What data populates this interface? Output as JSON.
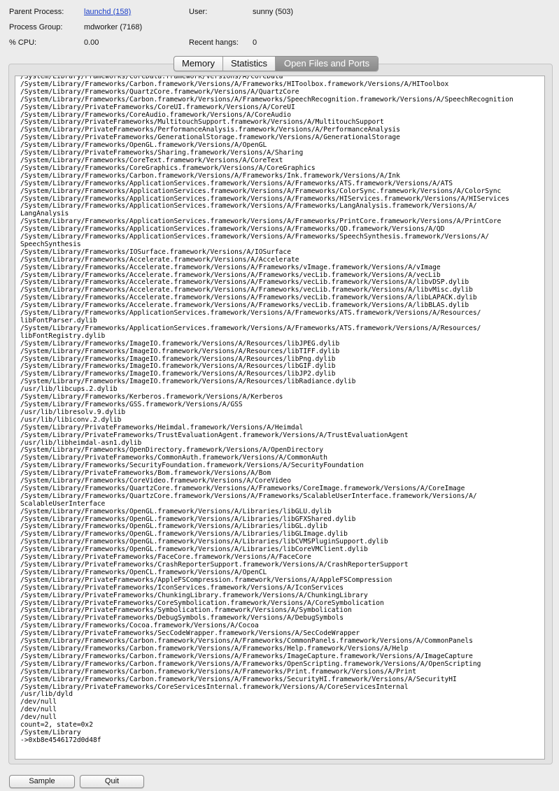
{
  "info": {
    "parent_process_label": "Parent Process:",
    "parent_process_value": "launchd (158)",
    "user_label": "User:",
    "user_value": "sunny (503)",
    "process_group_label": "Process Group:",
    "process_group_value": "mdworker (7168)",
    "cpu_label": "% CPU:",
    "cpu_value": "0.00",
    "recent_hangs_label": "Recent hangs:",
    "recent_hangs_value": "0"
  },
  "tabs": [
    {
      "label": "Memory",
      "active": false
    },
    {
      "label": "Statistics",
      "active": false
    },
    {
      "label": "Open Files and Ports",
      "active": true
    }
  ],
  "open_files": [
    "/System/Library/Frameworks/CoreData.framework/Versions/A/CoreData",
    "/System/Library/Frameworks/Carbon.framework/Versions/A/Frameworks/HIToolbox.framework/Versions/A/HIToolbox",
    "/System/Library/Frameworks/QuartzCore.framework/Versions/A/QuartzCore",
    "/System/Library/Frameworks/Carbon.framework/Versions/A/Frameworks/SpeechRecognition.framework/Versions/A/SpeechRecognition",
    "/System/Library/PrivateFrameworks/CoreUI.framework/Versions/A/CoreUI",
    "/System/Library/Frameworks/CoreAudio.framework/Versions/A/CoreAudio",
    "/System/Library/PrivateFrameworks/MultitouchSupport.framework/Versions/A/MultitouchSupport",
    "/System/Library/PrivateFrameworks/PerformanceAnalysis.framework/Versions/A/PerformanceAnalysis",
    "/System/Library/PrivateFrameworks/GenerationalStorage.framework/Versions/A/GenerationalStorage",
    "/System/Library/Frameworks/OpenGL.framework/Versions/A/OpenGL",
    "/System/Library/PrivateFrameworks/Sharing.framework/Versions/A/Sharing",
    "/System/Library/Frameworks/CoreText.framework/Versions/A/CoreText",
    "/System/Library/Frameworks/CoreGraphics.framework/Versions/A/CoreGraphics",
    "/System/Library/Frameworks/Carbon.framework/Versions/A/Frameworks/Ink.framework/Versions/A/Ink",
    "/System/Library/Frameworks/ApplicationServices.framework/Versions/A/Frameworks/ATS.framework/Versions/A/ATS",
    "/System/Library/Frameworks/ApplicationServices.framework/Versions/A/Frameworks/ColorSync.framework/Versions/A/ColorSync",
    "/System/Library/Frameworks/ApplicationServices.framework/Versions/A/Frameworks/HIServices.framework/Versions/A/HIServices",
    "/System/Library/Frameworks/ApplicationServices.framework/Versions/A/Frameworks/LangAnalysis.framework/Versions/A/\nLangAnalysis",
    "/System/Library/Frameworks/ApplicationServices.framework/Versions/A/Frameworks/PrintCore.framework/Versions/A/PrintCore",
    "/System/Library/Frameworks/ApplicationServices.framework/Versions/A/Frameworks/QD.framework/Versions/A/QD",
    "/System/Library/Frameworks/ApplicationServices.framework/Versions/A/Frameworks/SpeechSynthesis.framework/Versions/A/\nSpeechSynthesis",
    "/System/Library/Frameworks/IOSurface.framework/Versions/A/IOSurface",
    "/System/Library/Frameworks/Accelerate.framework/Versions/A/Accelerate",
    "/System/Library/Frameworks/Accelerate.framework/Versions/A/Frameworks/vImage.framework/Versions/A/vImage",
    "/System/Library/Frameworks/Accelerate.framework/Versions/A/Frameworks/vecLib.framework/Versions/A/vecLib",
    "/System/Library/Frameworks/Accelerate.framework/Versions/A/Frameworks/vecLib.framework/Versions/A/libvDSP.dylib",
    "/System/Library/Frameworks/Accelerate.framework/Versions/A/Frameworks/vecLib.framework/Versions/A/libvMisc.dylib",
    "/System/Library/Frameworks/Accelerate.framework/Versions/A/Frameworks/vecLib.framework/Versions/A/libLAPACK.dylib",
    "/System/Library/Frameworks/Accelerate.framework/Versions/A/Frameworks/vecLib.framework/Versions/A/libBLAS.dylib",
    "/System/Library/Frameworks/ApplicationServices.framework/Versions/A/Frameworks/ATS.framework/Versions/A/Resources/\nlibFontParser.dylib",
    "/System/Library/Frameworks/ApplicationServices.framework/Versions/A/Frameworks/ATS.framework/Versions/A/Resources/\nlibFontRegistry.dylib",
    "/System/Library/Frameworks/ImageIO.framework/Versions/A/Resources/libJPEG.dylib",
    "/System/Library/Frameworks/ImageIO.framework/Versions/A/Resources/libTIFF.dylib",
    "/System/Library/Frameworks/ImageIO.framework/Versions/A/Resources/libPng.dylib",
    "/System/Library/Frameworks/ImageIO.framework/Versions/A/Resources/libGIF.dylib",
    "/System/Library/Frameworks/ImageIO.framework/Versions/A/Resources/libJP2.dylib",
    "/System/Library/Frameworks/ImageIO.framework/Versions/A/Resources/libRadiance.dylib",
    "/usr/lib/libcups.2.dylib",
    "/System/Library/Frameworks/Kerberos.framework/Versions/A/Kerberos",
    "/System/Library/Frameworks/GSS.framework/Versions/A/GSS",
    "/usr/lib/libresolv.9.dylib",
    "/usr/lib/libiconv.2.dylib",
    "/System/Library/PrivateFrameworks/Heimdal.framework/Versions/A/Heimdal",
    "/System/Library/PrivateFrameworks/TrustEvaluationAgent.framework/Versions/A/TrustEvaluationAgent",
    "/usr/lib/libheimdal-asn1.dylib",
    "/System/Library/Frameworks/OpenDirectory.framework/Versions/A/OpenDirectory",
    "/System/Library/PrivateFrameworks/CommonAuth.framework/Versions/A/CommonAuth",
    "/System/Library/Frameworks/SecurityFoundation.framework/Versions/A/SecurityFoundation",
    "/System/Library/PrivateFrameworks/Bom.framework/Versions/A/Bom",
    "/System/Library/Frameworks/CoreVideo.framework/Versions/A/CoreVideo",
    "/System/Library/Frameworks/QuartzCore.framework/Versions/A/Frameworks/CoreImage.framework/Versions/A/CoreImage",
    "/System/Library/Frameworks/QuartzCore.framework/Versions/A/Frameworks/ScalableUserInterface.framework/Versions/A/\nScalableUserInterface",
    "/System/Library/Frameworks/OpenGL.framework/Versions/A/Libraries/libGLU.dylib",
    "/System/Library/Frameworks/OpenGL.framework/Versions/A/Libraries/libGFXShared.dylib",
    "/System/Library/Frameworks/OpenGL.framework/Versions/A/Libraries/libGL.dylib",
    "/System/Library/Frameworks/OpenGL.framework/Versions/A/Libraries/libGLImage.dylib",
    "/System/Library/Frameworks/OpenGL.framework/Versions/A/Libraries/libCVMSPluginSupport.dylib",
    "/System/Library/Frameworks/OpenGL.framework/Versions/A/Libraries/libCoreVMClient.dylib",
    "/System/Library/PrivateFrameworks/FaceCore.framework/Versions/A/FaceCore",
    "/System/Library/PrivateFrameworks/CrashReporterSupport.framework/Versions/A/CrashReporterSupport",
    "/System/Library/Frameworks/OpenCL.framework/Versions/A/OpenCL",
    "/System/Library/PrivateFrameworks/AppleFSCompression.framework/Versions/A/AppleFSCompression",
    "/System/Library/PrivateFrameworks/IconServices.framework/Versions/A/IconServices",
    "/System/Library/PrivateFrameworks/ChunkingLibrary.framework/Versions/A/ChunkingLibrary",
    "/System/Library/PrivateFrameworks/CoreSymbolication.framework/Versions/A/CoreSymbolication",
    "/System/Library/PrivateFrameworks/Symbolication.framework/Versions/A/Symbolication",
    "/System/Library/PrivateFrameworks/DebugSymbols.framework/Versions/A/DebugSymbols",
    "/System/Library/Frameworks/Cocoa.framework/Versions/A/Cocoa",
    "/System/Library/PrivateFrameworks/SecCodeWrapper.framework/Versions/A/SecCodeWrapper",
    "/System/Library/Frameworks/Carbon.framework/Versions/A/Frameworks/CommonPanels.framework/Versions/A/CommonPanels",
    "/System/Library/Frameworks/Carbon.framework/Versions/A/Frameworks/Help.framework/Versions/A/Help",
    "/System/Library/Frameworks/Carbon.framework/Versions/A/Frameworks/ImageCapture.framework/Versions/A/ImageCapture",
    "/System/Library/Frameworks/Carbon.framework/Versions/A/Frameworks/OpenScripting.framework/Versions/A/OpenScripting",
    "/System/Library/Frameworks/Carbon.framework/Versions/A/Frameworks/Print.framework/Versions/A/Print",
    "/System/Library/Frameworks/Carbon.framework/Versions/A/Frameworks/SecurityHI.framework/Versions/A/SecurityHI",
    "/System/Library/PrivateFrameworks/CoreServicesInternal.framework/Versions/A/CoreServicesInternal",
    "/usr/lib/dyld",
    "/dev/null",
    "/dev/null",
    "/dev/null",
    "count=2, state=0x2",
    "/System/Library",
    "->0xb8e4546172d0d48f"
  ],
  "buttons": {
    "sample": "Sample",
    "quit": "Quit"
  }
}
